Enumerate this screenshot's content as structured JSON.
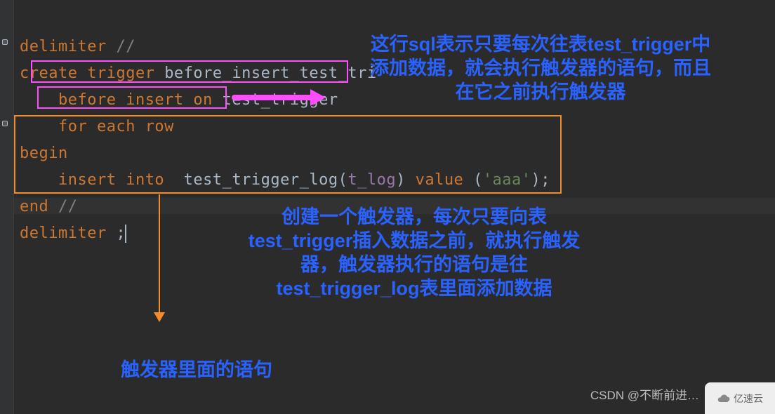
{
  "code": {
    "line1_kw": "delimiter ",
    "line1_cm": "//",
    "line2_kw": "create trigger ",
    "line2_id": "before_insert_test_tri",
    "line3_indent": "    ",
    "line3_kw": "before insert on ",
    "line3_id": "test_trigger",
    "line4_indent": "    ",
    "line4_kw": "for each row",
    "line5": "begin",
    "line6_indent": "    ",
    "line6_a": "insert into  ",
    "line6_b": "test_trigger_log(",
    "line6_col": "t_log",
    "line6_c": ") ",
    "line6_d": "value ",
    "line6_e": "(",
    "line6_str": "'aaa'",
    "line6_f": ");",
    "line7_a": "end ",
    "line7_cm": "//",
    "line8_a": "delimiter ",
    "line8_b": ";"
  },
  "annotations": {
    "a1": "这行sql表示只要每次往表test_trigger中添加数据，就会执行触发器的语句，而且在它之前执行触发器",
    "a2": "创建一个触发器，每次只要向表test_trigger插入数据之前，就执行触发器，触发器执行的语句是往test_trigger_log表里面添加数据",
    "a3": "触发器里面的语句"
  },
  "watermark": {
    "w1": "CSDN @不断前进…",
    "w2": "亿速云"
  }
}
